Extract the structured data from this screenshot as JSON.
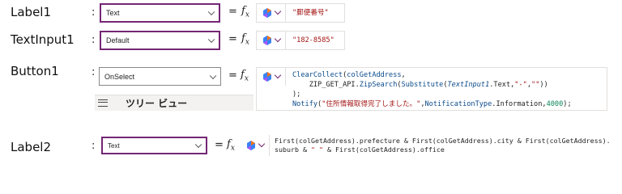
{
  "rows": [
    {
      "control": "Label1",
      "property": "Text",
      "tokens": [
        {
          "t": "\"郵便番号\"",
          "c": "str"
        }
      ]
    },
    {
      "control": "TextInput1",
      "property": "Default",
      "tokens": [
        {
          "t": "\"182-8585\"",
          "c": "str"
        }
      ]
    },
    {
      "control": "Button1",
      "property": "OnSelect",
      "code_lines": [
        [
          {
            "t": "ClearCollect",
            "c": "fn"
          },
          {
            "t": "(",
            "c": "op"
          },
          {
            "t": "colGetAddress",
            "c": "fn"
          },
          {
            "t": ",",
            "c": "op"
          }
        ],
        [
          {
            "t": "    ZIP_GET_API",
            "c": "op"
          },
          {
            "t": ".",
            "c": "op"
          },
          {
            "t": "ZipSearch",
            "c": "fn"
          },
          {
            "t": "(",
            "c": "op"
          },
          {
            "t": "Substitute",
            "c": "fn"
          },
          {
            "t": "(",
            "c": "op"
          },
          {
            "t": "TextInput1",
            "c": "id"
          },
          {
            "t": ".Text,",
            "c": "op"
          },
          {
            "t": "\"-\"",
            "c": "str"
          },
          {
            "t": ",",
            "c": "op"
          },
          {
            "t": "\"\"",
            "c": "str"
          },
          {
            "t": "))",
            "c": "op"
          }
        ],
        [
          {
            "t": ");",
            "c": "op"
          }
        ],
        [
          {
            "t": "Notify",
            "c": "fn"
          },
          {
            "t": "(",
            "c": "op"
          },
          {
            "t": "\"住所情報取得完了しました。\"",
            "c": "str"
          },
          {
            "t": ",",
            "c": "op"
          },
          {
            "t": "NotificationType",
            "c": "fn"
          },
          {
            "t": ".Information,",
            "c": "op"
          },
          {
            "t": "4000",
            "c": "num"
          },
          {
            "t": ");",
            "c": "op"
          }
        ]
      ]
    },
    {
      "control": "Label2",
      "property": "Text",
      "code_lines": [
        [
          {
            "t": "First(colGetAddress).prefecture & First(colGetAddress).city & First(colGetAddress).",
            "c": "op"
          }
        ],
        [
          {
            "t": "suburb & ",
            "c": "op"
          },
          {
            "t": "\" \"",
            "c": "str"
          },
          {
            "t": " & First(colGetAddress).office",
            "c": "op"
          }
        ]
      ]
    }
  ],
  "symbols": {
    "colon": ":",
    "equals": "=",
    "fx": "fx"
  },
  "tree_view": {
    "title": "ツリー ビュー"
  },
  "icons": {
    "copilot": "copilot-icon",
    "chevron": "chevron-down-icon",
    "menu": "hamburger-icon"
  },
  "colors": {
    "active_border": "#742774",
    "string": "#a31515",
    "function": "#0a4a8a",
    "number": "#098658"
  }
}
